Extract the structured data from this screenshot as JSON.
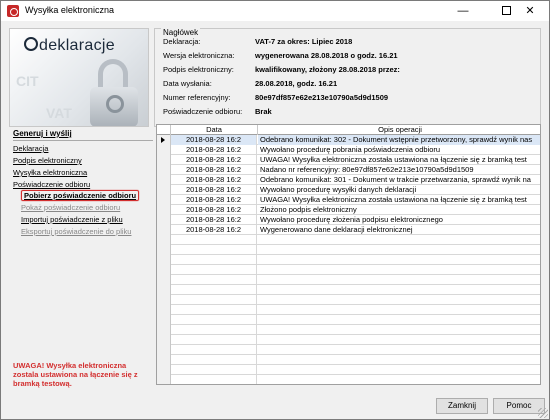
{
  "window": {
    "title": "Wysyłka elektroniczna",
    "min_label": "—",
    "close_label": "✕"
  },
  "logo": {
    "text": "deklaracje"
  },
  "header": {
    "legend": "Nagłówek",
    "rows": [
      {
        "label": "Deklaracja:",
        "value": "VAT-7 za okres: Lipiec 2018"
      },
      {
        "label": "Wersja elektroniczna:",
        "value": "wygenerowana 28.08.2018 o godz. 16.21"
      },
      {
        "label": "Podpis elektroniczny:",
        "value": "kwalifikowany, złożony 28.08.2018 przez:"
      },
      {
        "label": "Data wysłania:",
        "value": "28.08.2018, godz. 16.21"
      },
      {
        "label": "Numer referencyjny:",
        "value": "80e97df857e62e213e10790a5d9d1509"
      },
      {
        "label": "Poświadczenie odbioru:",
        "value": "Brak"
      }
    ]
  },
  "sidebar": {
    "title": "Generuj i wyślij",
    "links": [
      {
        "label": "Deklaracja"
      },
      {
        "label": "Podpis elektroniczny"
      },
      {
        "label": "Wysyłka elektroniczna"
      },
      {
        "label": "Poświadczenie odbioru"
      }
    ],
    "sublinks": [
      {
        "label": "Pobierz poświadczenie odbioru"
      },
      {
        "label": "Pokaż poświadczenie odbioru"
      },
      {
        "label": "Importuj poświadczenie z pliku"
      },
      {
        "label": "Eksportuj poświadczenie do pliku"
      }
    ],
    "warning": "UWAGA! Wysyłka elektroniczna zostala ustawiona na łączenie się z bramką testową."
  },
  "grid": {
    "columns": [
      "Data",
      "Opis operacji"
    ],
    "rows": [
      {
        "date": "2018-08-28 16:2",
        "op": "Odebrano komunikat: 302 - Dokument wstępnie przetworzony, sprawdź wynik nas"
      },
      {
        "date": "2018-08-28 16:2",
        "op": "Wywołano procedurę pobrania poświadczenia odbioru"
      },
      {
        "date": "2018-08-28 16:2",
        "op": "UWAGA! Wysyłka elektroniczna została ustawiona na łączenie się z bramką test"
      },
      {
        "date": "2018-08-28 16:2",
        "op": "Nadano nr referencyjny: 80e97df857e62e213e10790a5d9d1509"
      },
      {
        "date": "2018-08-28 16:2",
        "op": "Odebrano komunikat: 301 - Dokument w trakcie przetwarzania, sprawdź wynik na"
      },
      {
        "date": "2018-08-28 16:2",
        "op": "Wywołano procedurę wysyłki danych deklaracji"
      },
      {
        "date": "2018-08-28 16:2",
        "op": "UWAGA! Wysyłka elektroniczna została ustawiona na łączenie się z bramką test"
      },
      {
        "date": "2018-08-28 16:2",
        "op": "Złożono podpis elektroniczny"
      },
      {
        "date": "2018-08-28 16:2",
        "op": "Wywołano procedurę złożenia podpisu elektronicznego"
      },
      {
        "date": "2018-08-28 16:2",
        "op": "Wygenerowano dane deklaracji elektronicznej"
      }
    ]
  },
  "buttons": {
    "close": "Zamknij",
    "help": "Pomoc"
  }
}
